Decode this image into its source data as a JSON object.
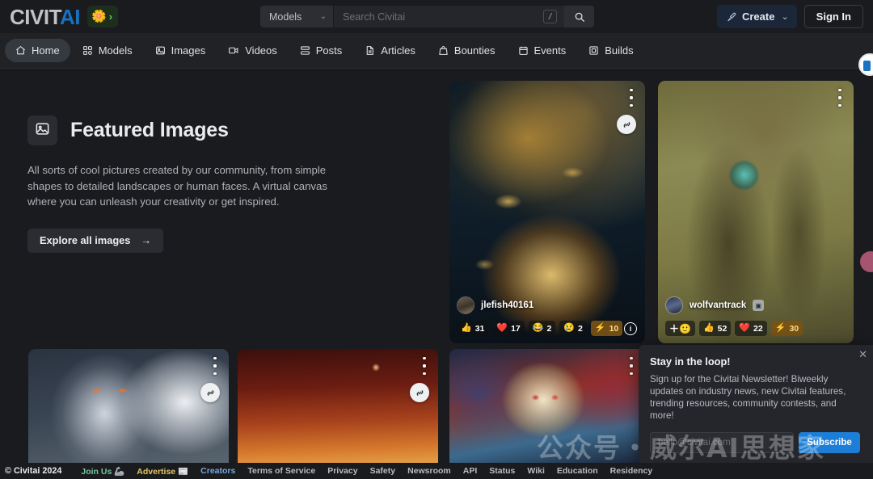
{
  "header": {
    "logo": {
      "text_c": "CIVIT",
      "text_ai": "AI",
      "badge_icon": "🌼",
      "badge_chevron": "›"
    },
    "search": {
      "category_label": "Models",
      "placeholder": "Search Civitai",
      "value": "",
      "kbd_hint": "/"
    },
    "create_label": "Create",
    "signin_label": "Sign In"
  },
  "nav": {
    "items": [
      {
        "label": "Home",
        "icon": "home-icon",
        "active": true
      },
      {
        "label": "Models",
        "icon": "grid-icon",
        "active": false
      },
      {
        "label": "Images",
        "icon": "image-icon",
        "active": false
      },
      {
        "label": "Videos",
        "icon": "video-icon",
        "active": false
      },
      {
        "label": "Posts",
        "icon": "posts-icon",
        "active": false
      },
      {
        "label": "Articles",
        "icon": "article-icon",
        "active": false
      },
      {
        "label": "Bounties",
        "icon": "bounty-icon",
        "active": false
      },
      {
        "label": "Events",
        "icon": "calendar-icon",
        "active": false
      },
      {
        "label": "Builds",
        "icon": "builds-icon",
        "active": false
      }
    ]
  },
  "hero": {
    "icon": "image-icon",
    "title": "Featured Images",
    "description": "All sorts of cool pictures created by our community, from simple shapes to detailed landscapes or human faces. A virtual canvas where you can unleash your creativity or get inspired.",
    "button_label": "Explore all images",
    "button_arrow": "→"
  },
  "cards": {
    "top": [
      {
        "id": "card-golden-tree",
        "username": "jlefish40161",
        "has_verified_badge": false,
        "stats": [
          {
            "icon": "👍",
            "count": "31",
            "type": "like"
          },
          {
            "icon": "❤️",
            "count": "17",
            "type": "heart"
          },
          {
            "icon": "😂",
            "count": "2",
            "type": "laugh"
          },
          {
            "icon": "😢",
            "count": "2",
            "type": "cry"
          },
          {
            "icon": "⚡",
            "count": "10",
            "type": "tip"
          }
        ],
        "info_badge": "i",
        "has_chain_button": true,
        "has_menu": true
      },
      {
        "id": "card-dryad",
        "username": "wolfvantrack",
        "has_verified_badge": true,
        "stats": [
          {
            "icon": "＋🙂",
            "count": "",
            "type": "react"
          },
          {
            "icon": "👍",
            "count": "52",
            "type": "like"
          },
          {
            "icon": "❤️",
            "count": "22",
            "type": "heart"
          },
          {
            "icon": "⚡",
            "count": "30",
            "type": "tip"
          }
        ],
        "info_badge": "",
        "has_chain_button": false,
        "has_menu": true
      }
    ],
    "bottom": [
      {
        "id": "card-cyborg",
        "has_chain_button": true,
        "has_menu": true
      },
      {
        "id": "card-red-moon",
        "has_chain_button": true,
        "has_menu": true
      },
      {
        "id": "card-skull",
        "has_chain_button": false,
        "has_menu": true
      },
      {
        "id": "card-wheat",
        "has_chain_button": false,
        "has_menu": true
      }
    ]
  },
  "newsletter": {
    "title": "Stay in the loop!",
    "body": "Sign up for the Civitai Newsletter! Biweekly updates on industry news, new Civitai features, trending resources, community contests, and more!",
    "email_placeholder": "hello@civitai.com",
    "email_value": "",
    "subscribe_label": "Subscribe",
    "close_label": "✕"
  },
  "watermark": {
    "text": "公众号・威尔AI思想家"
  },
  "footer": {
    "copyright": "© Civitai 2024",
    "links": [
      {
        "label": "Join Us 🦾",
        "style": "joinus"
      },
      {
        "label": "Advertise 📰",
        "style": "advertise"
      },
      {
        "label": "Creators",
        "style": "creators"
      },
      {
        "label": "Terms of Service",
        "style": ""
      },
      {
        "label": "Privacy",
        "style": ""
      },
      {
        "label": "Safety",
        "style": ""
      },
      {
        "label": "Newsroom",
        "style": ""
      },
      {
        "label": "API",
        "style": ""
      },
      {
        "label": "Status",
        "style": ""
      },
      {
        "label": "Wiki",
        "style": ""
      },
      {
        "label": "Education",
        "style": ""
      },
      {
        "label": "Residency",
        "style": ""
      }
    ]
  },
  "colors": {
    "background": "#1a1b1e",
    "nav_bg": "#212225",
    "accent_blue": "#1c7ed6",
    "logo_blue": "#1971c2",
    "tip_gold": "#ffd98a"
  }
}
